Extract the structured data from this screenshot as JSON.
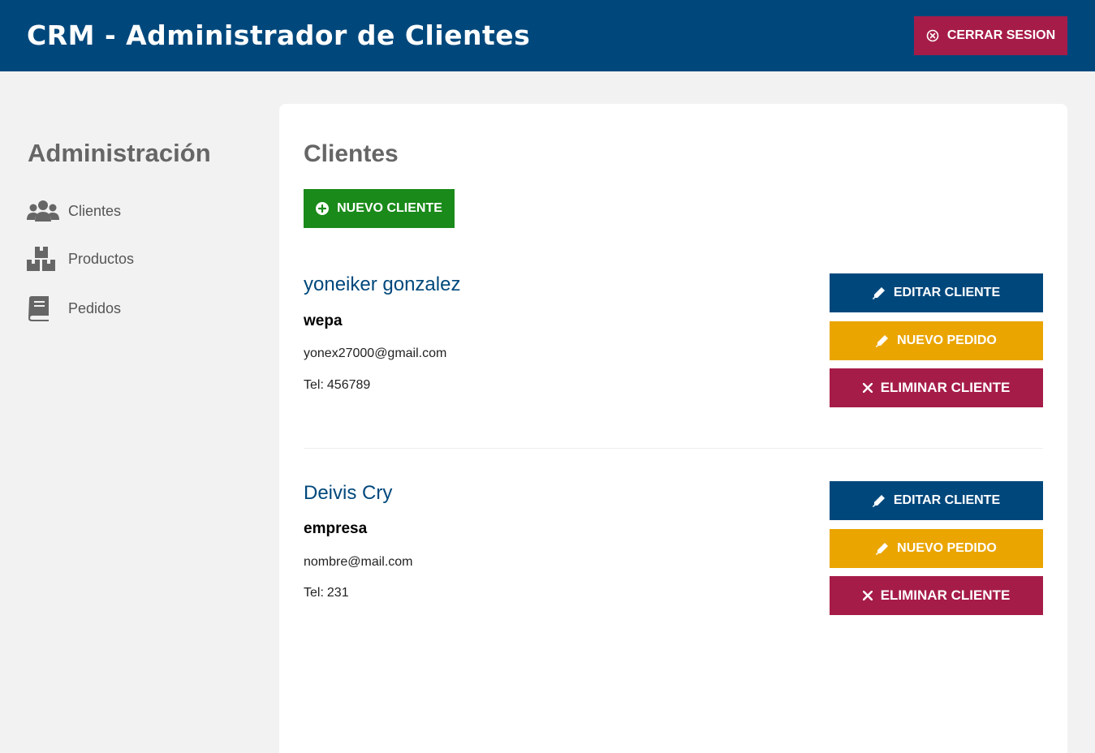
{
  "header": {
    "title": "CRM - Administrador de Clientes",
    "logout_label": "CERRAR SESION",
    "background": "#00487c"
  },
  "sidebar": {
    "title": "Administración",
    "items": [
      {
        "label": "Clientes",
        "icon": "users-icon"
      },
      {
        "label": "Productos",
        "icon": "boxes-icon"
      },
      {
        "label": "Pedidos",
        "icon": "book-icon"
      }
    ]
  },
  "main": {
    "title": "Clientes",
    "new_client_label": "NUEVO CLIENTE",
    "clients": [
      {
        "name": "yoneiker gonzalez",
        "company": "wepa",
        "email": "yonex27000@gmail.com",
        "phone_prefix": "Tel:",
        "phone": "456789",
        "edit_label": "EDITAR CLIENTE",
        "order_label": "NUEVO PEDIDO",
        "delete_label": "ELIMINAR CLIENTE"
      },
      {
        "name": "Deivis Cry",
        "company": "empresa",
        "email": "nombre@mail.com",
        "phone_prefix": "Tel:",
        "phone": "231",
        "edit_label": "EDITAR CLIENTE",
        "order_label": "NUEVO PEDIDO",
        "delete_label": "ELIMINAR CLIENTE"
      }
    ]
  },
  "colors": {
    "primary": "#00487c",
    "danger": "#a61c48",
    "success": "#1a8a1a",
    "warning": "#eaa500"
  }
}
